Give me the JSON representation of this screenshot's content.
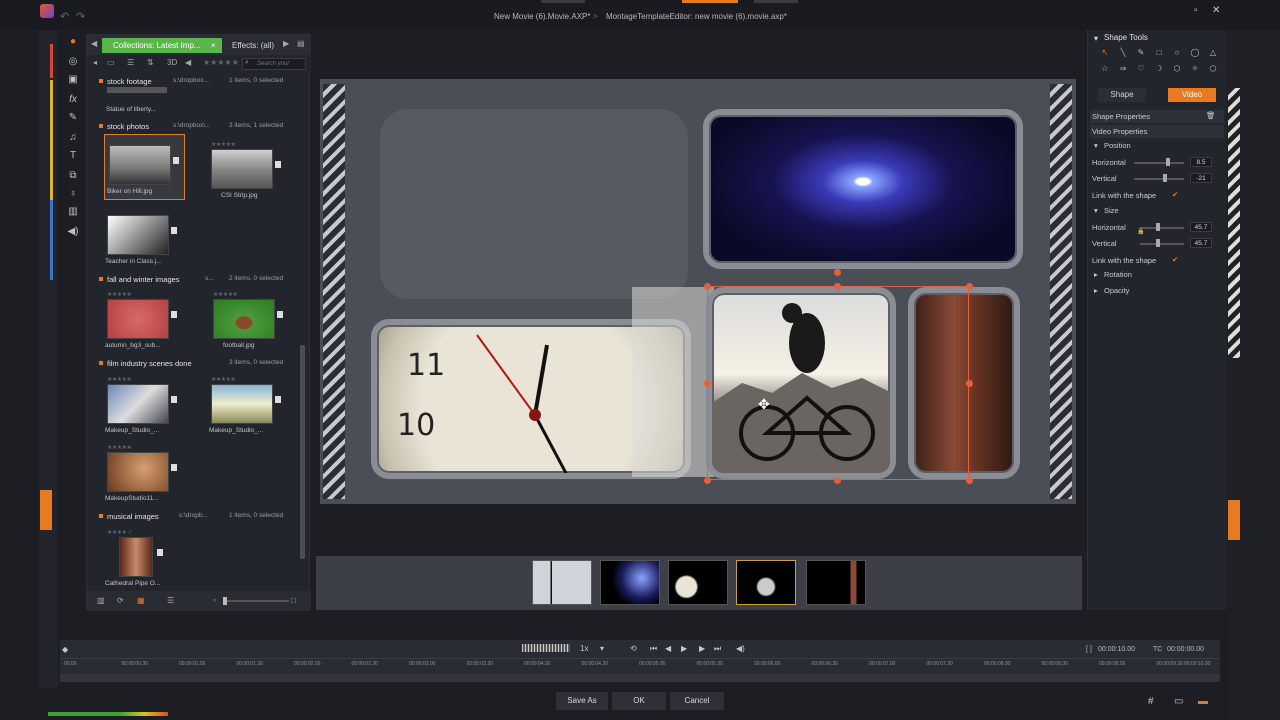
{
  "titlebar": {
    "project": "New Movie (6).Movie.AXP*",
    "separator": ">",
    "editor": "MontageTemplateEditor: new movie (6).movie.axp*"
  },
  "library": {
    "tab_active": "Collections: Latest Imp...",
    "tab_close": "×",
    "tab_effects": "Effects: (all)",
    "toolbar_3d": "3D",
    "search_placeholder": "Search your",
    "groups": [
      {
        "name": "stock footage",
        "path": "s:\\dropbox...",
        "count": "1 items, 0 selected"
      },
      {
        "name": "stock photos",
        "path": "s:\\dropbox\\...",
        "count": "3 items, 1 selected"
      },
      {
        "name": "fall and winter images",
        "path": "s...",
        "count": "2 items, 0 selected"
      },
      {
        "name": "film industry scenes done",
        "path": "",
        "count": "3 items, 0 selected"
      },
      {
        "name": "musical images",
        "path": "s:\\dropb...",
        "count": "1 items, 0 selected"
      }
    ],
    "captions": {
      "statue": "Statue of liberty...",
      "biker": "Biker on Hill.jpg",
      "csi": "CSI Strip.jpg",
      "teacher": "Teacher in Class.j...",
      "autumn": "autumn_bg3_sub...",
      "football": "football.jpg",
      "makeup1": "Makeup_Studio_...",
      "makeup2": "Makeup_Studio_...",
      "makeup3": "MakeupStudio11...",
      "cathedral": "Cathedral Pipe O..."
    }
  },
  "right_panel": {
    "shape_tools": "Shape Tools",
    "tab_shape": "Shape",
    "tab_video": "Video",
    "shape_properties": "Shape Properties",
    "video_properties": "Video Properties",
    "position": "Position",
    "horizontal": "Horizontal",
    "horizontal_pos_val": "8.5",
    "vertical": "Vertical",
    "vertical_pos_val": "-21",
    "link_shape": "Link with the shape",
    "size": "Size",
    "horizontal_size_val": "45.7",
    "vertical_size_val": "45.7",
    "rotation": "Rotation",
    "opacity": "Opacity"
  },
  "timeline": {
    "speed": "1x",
    "timecode": "00:00:10.00",
    "tc_label": "TC",
    "tc_value": "00:00:00.00",
    "ticks": [
      "00.00",
      "00:00:00.30",
      "00:00:01.00",
      "00:00:01.30",
      "00:00:02.00",
      "00:00:02.30",
      "00:00:03.00",
      "00:00:03.30",
      "00:00:04.00",
      "00:00:04.30",
      "00:00:05.00",
      "00:00:05.30",
      "00:00:06.00",
      "00:00:06.30",
      "00:00:07.00",
      "00:00:07.30",
      "00:00:08.00",
      "00:00:08.30",
      "00:00:09.00",
      "00:00:09.30",
      "00:00:10.00"
    ]
  },
  "footer": {
    "save_as": "Save As",
    "ok": "OK",
    "cancel": "Cancel"
  },
  "colors": {
    "accent": "#e87a22",
    "green_tab": "#5ab54a"
  }
}
